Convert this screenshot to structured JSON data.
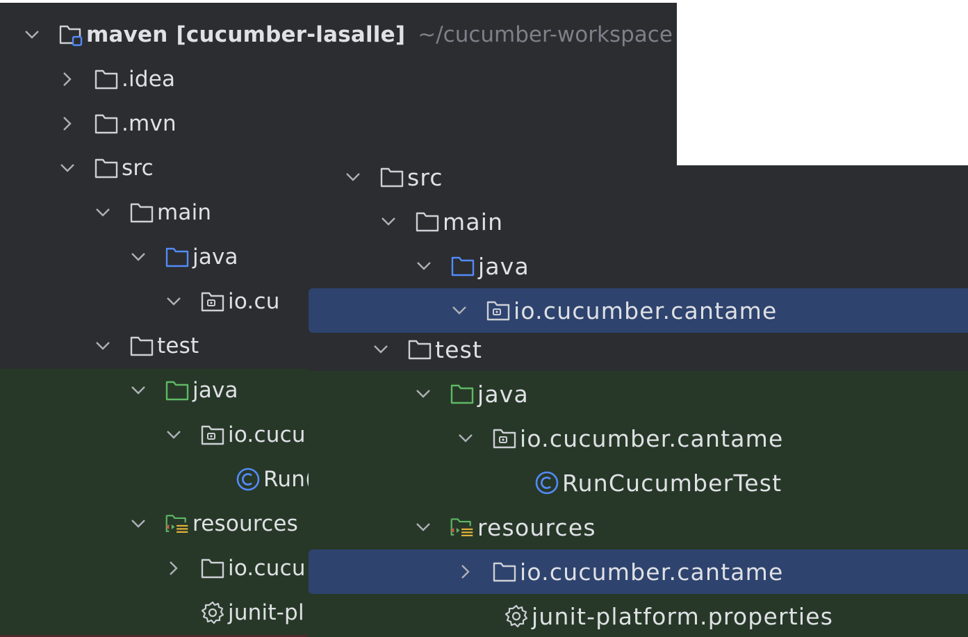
{
  "colors": {
    "panel_bg": "#2b2d30",
    "test_bg": "#273828",
    "selection": "#2e436e",
    "text": "#dfe1e5",
    "muted": "#7d8088",
    "folder_icon": "#ced0d6",
    "source_folder": "#548af7",
    "test_folder": "#5fb865",
    "class_icon": "#548af7"
  },
  "left_tree": {
    "root": {
      "label": "maven",
      "module": "[cucumber-lasalle]",
      "path": "~/cucumber-workspace"
    },
    "items": [
      {
        "label": ".idea",
        "icon": "folder-icon",
        "chevron": "right"
      },
      {
        "label": ".mvn",
        "icon": "folder-icon",
        "chevron": "right"
      },
      {
        "label": "src",
        "icon": "folder-icon",
        "chevron": "down"
      },
      {
        "label": "main",
        "icon": "folder-icon",
        "chevron": "down"
      },
      {
        "label": "java",
        "icon": "source-folder-icon",
        "chevron": "down"
      },
      {
        "label": "io.cu",
        "icon": "package-icon",
        "chevron": "down"
      },
      {
        "label": "test",
        "icon": "folder-icon",
        "chevron": "down"
      },
      {
        "label": "java",
        "icon": "test-folder-icon",
        "chevron": "down"
      },
      {
        "label": "io.cucu",
        "icon": "package-icon",
        "chevron": "down"
      },
      {
        "label": "Run(",
        "icon": "class-icon",
        "chevron": "none"
      },
      {
        "label": "resources",
        "icon": "test-resources-icon",
        "chevron": "down"
      },
      {
        "label": "io.cucu",
        "icon": "folder-icon",
        "chevron": "right"
      },
      {
        "label": "junit-pl",
        "icon": "settings-file-icon",
        "chevron": "none"
      }
    ]
  },
  "right_tree": {
    "items": [
      {
        "label": "src",
        "icon": "folder-icon",
        "chevron": "down"
      },
      {
        "label": "main",
        "icon": "folder-icon",
        "chevron": "down"
      },
      {
        "label": "java",
        "icon": "source-folder-icon",
        "chevron": "down"
      },
      {
        "label": "io.cucumber.cantame",
        "icon": "package-icon",
        "chevron": "down",
        "selected": true
      },
      {
        "label": "test",
        "icon": "folder-icon",
        "chevron": "down"
      },
      {
        "label": "java",
        "icon": "test-folder-icon",
        "chevron": "down"
      },
      {
        "label": "io.cucumber.cantame",
        "icon": "package-icon",
        "chevron": "down"
      },
      {
        "label": "RunCucumberTest",
        "icon": "class-icon",
        "chevron": "none"
      },
      {
        "label": "resources",
        "icon": "test-resources-icon",
        "chevron": "down"
      },
      {
        "label": "io.cucumber.cantame",
        "icon": "folder-icon",
        "chevron": "right",
        "selected": true
      },
      {
        "label": "junit-platform.properties",
        "icon": "settings-file-icon",
        "chevron": "none"
      }
    ]
  }
}
